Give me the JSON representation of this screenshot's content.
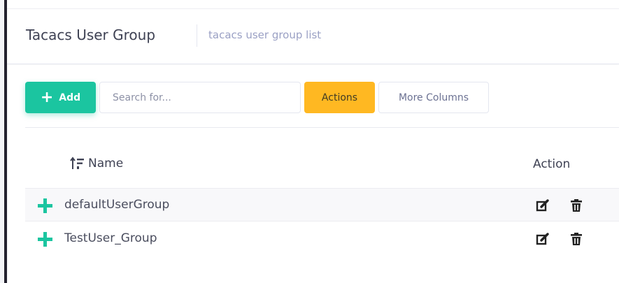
{
  "header": {
    "title": "Tacacs User Group",
    "subtitle": "tacacs user group list"
  },
  "toolbar": {
    "add_label": "Add",
    "search_placeholder": "Search for...",
    "actions_label": "Actions",
    "more_columns_label": "More Columns"
  },
  "table": {
    "columns": [
      "Name",
      "Action"
    ],
    "rows": [
      {
        "name": "defaultUserGroup"
      },
      {
        "name": "TestUser_Group"
      }
    ]
  },
  "icons": {
    "sort": "sort-icon",
    "expand": "plus-icon",
    "edit": "edit-icon",
    "delete": "trash-icon"
  },
  "colors": {
    "primary": "#1bc5a0",
    "warning": "#ffb822",
    "subtitle": "#9aa0c4",
    "sidebar_edge": "#23222e"
  }
}
